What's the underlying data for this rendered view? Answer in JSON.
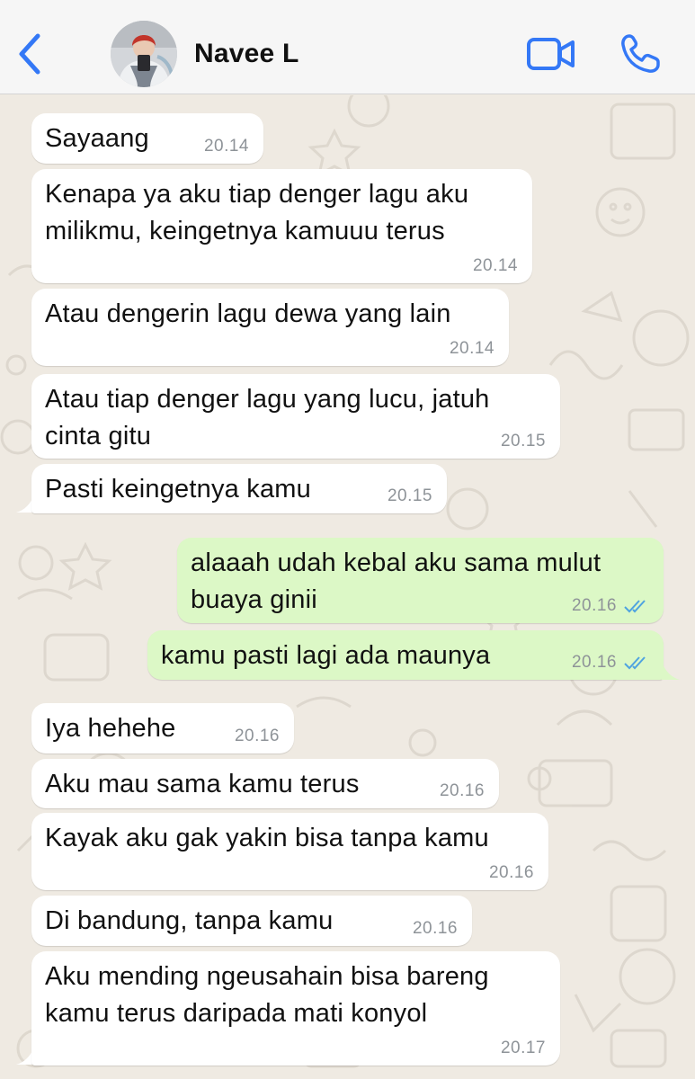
{
  "header": {
    "contact_name": "Navee L",
    "back_icon": "chevron-left-icon",
    "video_icon": "video-camera-icon",
    "call_icon": "phone-icon",
    "accent_color": "#3478f6"
  },
  "messages": [
    {
      "text": "Sayaang",
      "time": "20.14",
      "dir": "in"
    },
    {
      "text": "Kenapa ya aku tiap denger lagu aku\nmilikmu, keingetnya kamuuu terus",
      "time": "20.14",
      "dir": "in"
    },
    {
      "text": "Atau dengerin lagu dewa yang lain",
      "time": "20.14",
      "dir": "in"
    },
    {
      "text": "Atau tiap denger lagu yang lucu, jatuh\ncinta gitu",
      "time": "20.15",
      "dir": "in"
    },
    {
      "text": "Pasti keingetnya kamu",
      "time": "20.15",
      "dir": "in"
    },
    {
      "text": "alaaah udah kebal aku sama mulut\nbuaya ginii",
      "time": "20.16",
      "dir": "out",
      "status": "read"
    },
    {
      "text": "kamu pasti lagi ada maunya",
      "time": "20.16",
      "dir": "out",
      "status": "read"
    },
    {
      "text": "Iya hehehe",
      "time": "20.16",
      "dir": "in"
    },
    {
      "text": "Aku mau sama kamu terus",
      "time": "20.16",
      "dir": "in"
    },
    {
      "text": "Kayak aku gak yakin bisa tanpa kamu",
      "time": "20.16",
      "dir": "in"
    },
    {
      "text": "Di bandung, tanpa kamu",
      "time": "20.16",
      "dir": "in"
    },
    {
      "text": "Aku mending ngeusahain bisa bareng\nkamu terus daripada mati konyol",
      "time": "20.17",
      "dir": "in"
    }
  ],
  "colors": {
    "incoming_bubble": "#ffffff",
    "outgoing_bubble": "#dcf8c6",
    "read_ticks": "#4fa3e0",
    "chat_background": "#efeae2"
  }
}
